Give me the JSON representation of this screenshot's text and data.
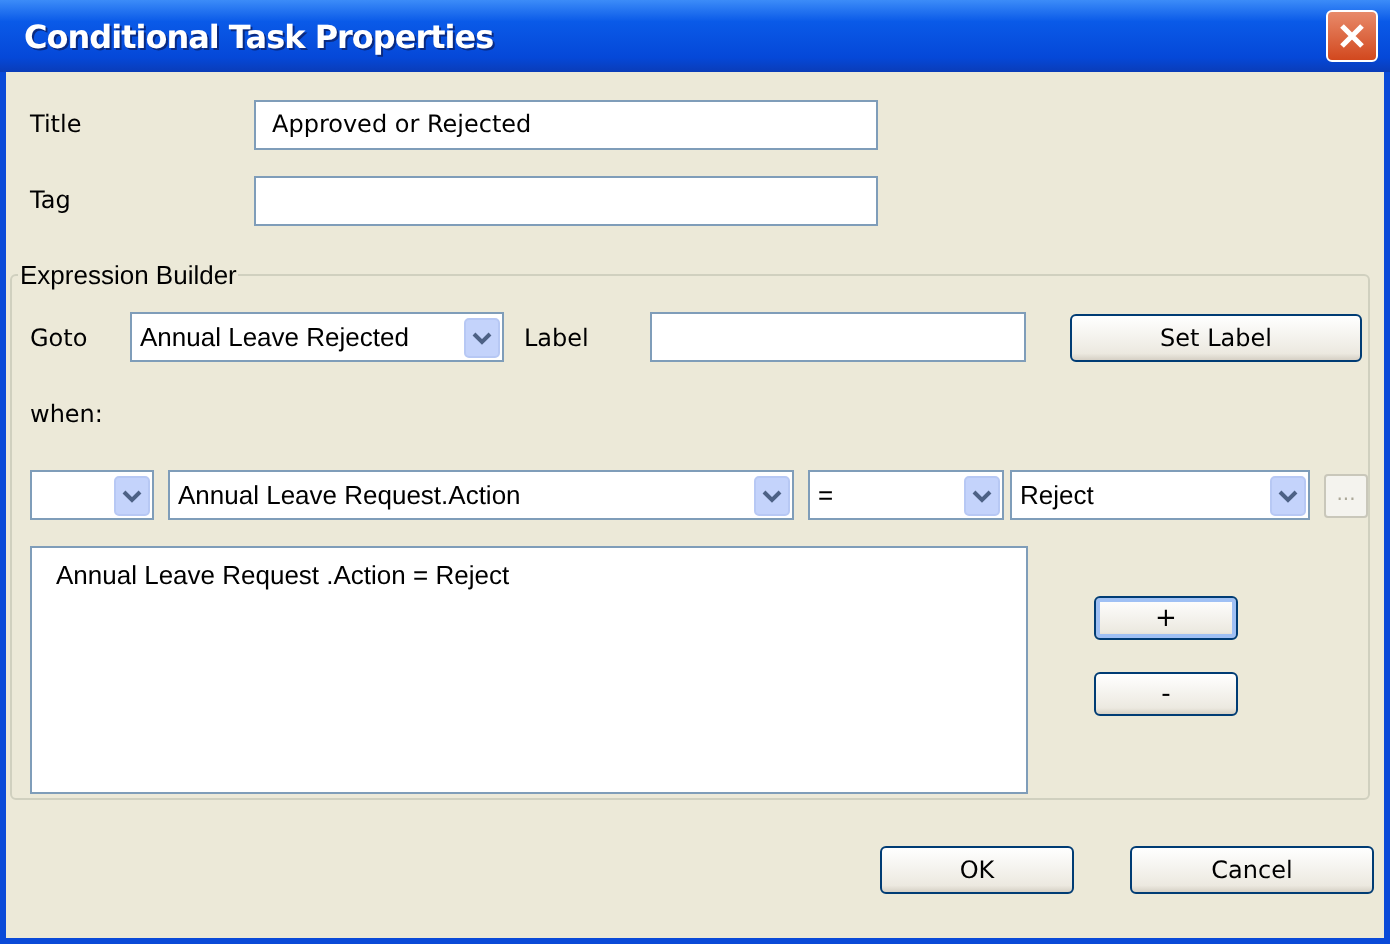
{
  "window": {
    "title": "Conditional Task Properties"
  },
  "fields": [
    {
      "label": "Title",
      "value": "Approved or Rejected"
    },
    {
      "label": "Tag"
    }
  ],
  "expression_builder": {
    "legend": "Expression Builder",
    "goto": {
      "label": "Goto",
      "value": "Annual Leave Rejected"
    },
    "label_field": {
      "label": "Label"
    },
    "set_label_button": "Set Label",
    "when_label": "when:",
    "condition_dropdowns": [
      {
        "kind": "empty"
      },
      {
        "kind": "value",
        "value": "Annual Leave Request.Action"
      },
      {
        "kind": "value",
        "value": "="
      },
      {
        "kind": "value",
        "value": "Reject"
      }
    ],
    "browse_button": {
      "text": "...",
      "disabled": true
    },
    "expressions": [
      "Annual Leave Request .Action = Reject"
    ],
    "add_button": "+",
    "remove_button": "-"
  },
  "buttons": [
    "OK",
    "Cancel"
  ]
}
